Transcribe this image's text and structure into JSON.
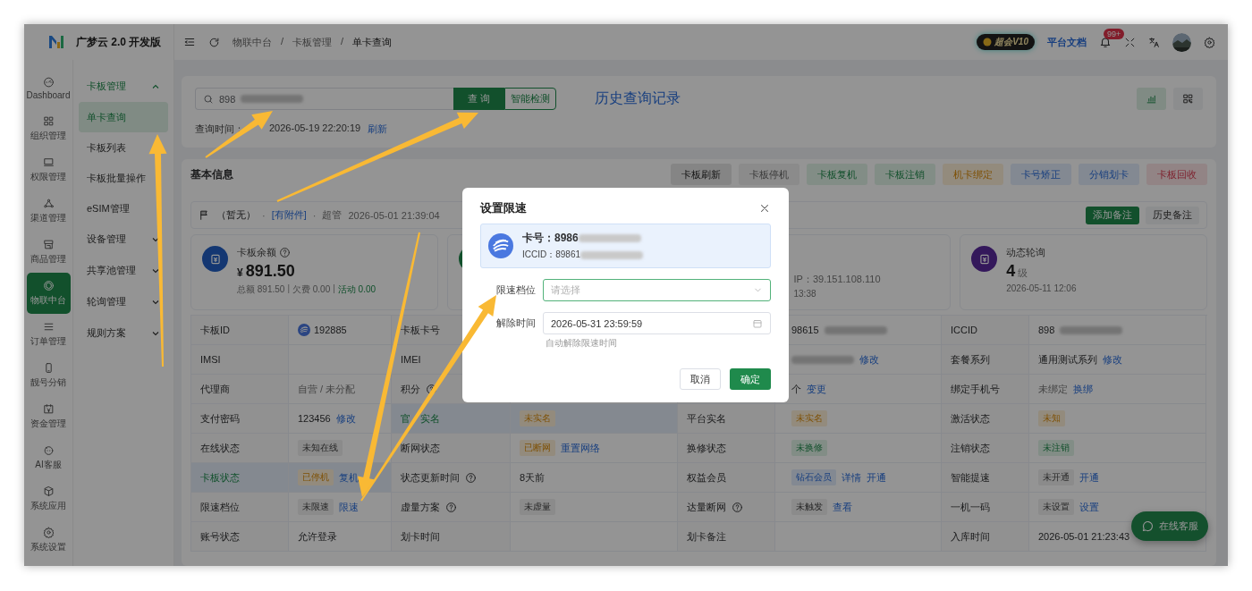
{
  "app": {
    "name": "广梦云 2.0 开发版"
  },
  "rail": [
    {
      "label": "Dashboard",
      "selected": false
    },
    {
      "label": "组织管理",
      "selected": false
    },
    {
      "label": "权限管理",
      "selected": false
    },
    {
      "label": "渠道管理",
      "selected": false
    },
    {
      "label": "商品管理",
      "selected": false
    },
    {
      "label": "物联中台",
      "selected": true
    },
    {
      "label": "订单管理",
      "selected": false
    },
    {
      "label": "靓号分销",
      "selected": false
    },
    {
      "label": "资金管理",
      "selected": false
    },
    {
      "label": "AI客服",
      "selected": false
    },
    {
      "label": "系统应用",
      "selected": false
    },
    {
      "label": "系统设置",
      "selected": false
    }
  ],
  "sidebar": {
    "items": [
      {
        "label": "卡板管理",
        "expanded": true,
        "children": [
          {
            "label": "单卡查询",
            "selected": true
          },
          {
            "label": "卡板列表",
            "selected": false
          },
          {
            "label": "卡板批量操作",
            "selected": false
          },
          {
            "label": "eSIM管理",
            "selected": false
          }
        ]
      },
      {
        "label": "设备管理",
        "expanded": false
      },
      {
        "label": "共享池管理",
        "expanded": false
      },
      {
        "label": "轮询管理",
        "expanded": false
      },
      {
        "label": "规则方案",
        "expanded": false
      }
    ]
  },
  "breadcrumb": [
    "物联中台",
    "/",
    "卡板管理",
    "/",
    "单卡查询"
  ],
  "header": {
    "vip_badge": "超会V10",
    "docs_link": "平台文档",
    "notification_count": "99+"
  },
  "query": {
    "search_value": "898",
    "search_button": "查 询",
    "detect_button": "智能检测",
    "history_link": "历史查询记录",
    "query_time_label": "查询时间：",
    "query_time": "2026-05-19 22:20:19",
    "refresh_link": "刷新"
  },
  "info": {
    "title": "基本信息",
    "actions": [
      {
        "label": "卡板刷新",
        "kind": "dark"
      },
      {
        "label": "卡板停机",
        "kind": "gray"
      },
      {
        "label": "卡板复机",
        "kind": "success"
      },
      {
        "label": "卡板注销",
        "kind": "success"
      },
      {
        "label": "机卡绑定",
        "kind": "warning"
      },
      {
        "label": "卡号矫正",
        "kind": "info"
      },
      {
        "label": "分销划卡",
        "kind": "info"
      },
      {
        "label": "卡板回收",
        "kind": "danger"
      }
    ],
    "remark": {
      "parts": [
        {
          "kind": "text",
          "text": "（暂无）"
        },
        {
          "kind": "dot",
          "text": "·"
        },
        {
          "kind": "link",
          "text": "[有附件]"
        },
        {
          "kind": "dot",
          "text": "·"
        },
        {
          "kind": "muted",
          "text": "超管"
        },
        {
          "kind": "muted",
          "text": "2026-05-01 21:39:04"
        }
      ],
      "buttons": [
        {
          "label": "添加备注",
          "kind": "primary"
        },
        {
          "label": "历史备注",
          "kind": "plain"
        }
      ]
    },
    "cards": [
      {
        "kind": "blue",
        "title": "卡板余额",
        "help": true,
        "currency": "¥",
        "value": "891.50",
        "footer": [
          {
            "kind": "muted",
            "text": "总额 891.50"
          },
          {
            "kind": "sep",
            "text": "|"
          },
          {
            "kind": "muted",
            "text": "欠费 0.00"
          },
          {
            "kind": "sep",
            "text": "|"
          },
          {
            "kind": "success",
            "text": "活动 0.00"
          }
        ]
      },
      {
        "kind": "green"
      },
      {
        "subtitle": "IP：39.151.108.110",
        "footer": [
          {
            "kind": "muted",
            "text": "13:38"
          }
        ]
      },
      {
        "kind": "purple",
        "title": "动态轮询",
        "help": false,
        "value": "4",
        "unit": "级",
        "footer": [
          {
            "kind": "muted",
            "text": "2026-05-11 12:06"
          }
        ]
      }
    ],
    "table": {
      "rows": [
        {
          "pairs": [
            {
              "label": "卡板ID",
              "help": false,
              "highlighted": false,
              "parts": [
                {
                  "kind": "chip",
                  "text": "192885"
                }
              ]
            },
            {
              "label": "卡板卡号",
              "help": false,
              "highlighted": false
            },
            {
              "parts": [
                {
                  "kind": "text",
                  "text": "98615"
                },
                {
                  "kind": "redacted"
                }
              ]
            },
            {
              "label": "ICCID",
              "help": false,
              "highlighted": false,
              "parts": [
                {
                  "kind": "text",
                  "text": "898"
                },
                {
                  "kind": "redacted"
                }
              ]
            }
          ]
        },
        {
          "pairs": [
            {
              "label": "IMSI",
              "help": false,
              "highlighted": false
            },
            {
              "label": "IMEI",
              "help": false,
              "highlighted": false
            },
            {
              "parts": [
                {
                  "kind": "redacted"
                },
                {
                  "kind": "link",
                  "text": "修改"
                }
              ]
            },
            {
              "label": "套餐系列",
              "help": false,
              "highlighted": false,
              "parts": [
                {
                  "kind": "text",
                  "text": "通用测试系列"
                },
                {
                  "kind": "link",
                  "text": "修改"
                }
              ]
            }
          ]
        },
        {
          "pairs": [
            {
              "label": "代理商",
              "help": false,
              "highlighted": false,
              "parts": [
                {
                  "kind": "muted",
                  "text": "自营 / 未分配"
                }
              ]
            },
            {
              "label": "积分",
              "help": true,
              "highlighted": false
            },
            {
              "parts": [
                {
                  "kind": "text",
                  "text": "个"
                },
                {
                  "kind": "link",
                  "text": "变更"
                }
              ]
            },
            {
              "label": "绑定手机号",
              "help": false,
              "highlighted": false,
              "parts": [
                {
                  "kind": "muted",
                  "text": "未绑定"
                },
                {
                  "kind": "link",
                  "text": "换绑"
                }
              ]
            }
          ]
        },
        {
          "pairs": [
            {
              "label": "支付密码",
              "help": false,
              "highlighted": false,
              "parts": [
                {
                  "kind": "text",
                  "text": "123456"
                },
                {
                  "kind": "link",
                  "text": "修改"
                }
              ]
            },
            {
              "label": "官",
              "label_2": "实名",
              "help": false,
              "highlighted": true,
              "parts": [
                {
                  "kind": "warning-tag",
                  "text": "未实名"
                }
              ]
            },
            {
              "label": "平台实名",
              "help": false,
              "highlighted": false,
              "parts": [
                {
                  "kind": "warning-tag",
                  "text": "未实名"
                }
              ]
            },
            {
              "label": "激活状态",
              "help": false,
              "highlighted": false,
              "parts": [
                {
                  "kind": "warning-tag",
                  "text": "未知"
                }
              ]
            }
          ]
        },
        {
          "pairs": [
            {
              "label": "在线状态",
              "help": false,
              "highlighted": false,
              "parts": [
                {
                  "kind": "plain-tag",
                  "text": "未知在线"
                }
              ]
            },
            {
              "label": "断网状态",
              "help": false,
              "highlighted": false,
              "parts": [
                {
                  "kind": "warning-tag",
                  "text": "已断网"
                },
                {
                  "kind": "link",
                  "text": "重置网络"
                }
              ]
            },
            {
              "label": "换修状态",
              "help": false,
              "highlighted": false,
              "parts": [
                {
                  "kind": "success-tag",
                  "text": "未换修"
                }
              ]
            },
            {
              "label": "注销状态",
              "help": false,
              "highlighted": false,
              "parts": [
                {
                  "kind": "success-tag",
                  "text": "未注销"
                }
              ]
            }
          ]
        },
        {
          "pairs": [
            {
              "label": "卡板状态",
              "help": false,
              "highlighted": true,
              "parts": [
                {
                  "kind": "warning-tag",
                  "text": "已停机"
                },
                {
                  "kind": "link",
                  "text": "复机"
                }
              ]
            },
            {
              "label": "状态更新时间",
              "help": true,
              "highlighted": false,
              "parts": [
                {
                  "kind": "text",
                  "text": "8天前"
                }
              ]
            },
            {
              "label": "权益会员",
              "help": false,
              "highlighted": false,
              "parts": [
                {
                  "kind": "info-tag",
                  "text": "钻石会员"
                },
                {
                  "kind": "link",
                  "text": "详情"
                },
                {
                  "kind": "link",
                  "text": "开通"
                }
              ]
            },
            {
              "label": "智能提速",
              "help": false,
              "highlighted": false,
              "parts": [
                {
                  "kind": "plain-tag",
                  "text": "未开通"
                },
                {
                  "kind": "link",
                  "text": "开通"
                }
              ]
            }
          ]
        },
        {
          "pairs": [
            {
              "label": "限速档位",
              "help": false,
              "highlighted": false,
              "parts": [
                {
                  "kind": "plain-tag",
                  "text": "未限速"
                },
                {
                  "kind": "link",
                  "text": "限速"
                }
              ]
            },
            {
              "label": "虚量方案",
              "help": true,
              "highlighted": false,
              "parts": [
                {
                  "kind": "plain-tag",
                  "text": "未虚量"
                }
              ]
            },
            {
              "label": "达量断网",
              "help": true,
              "highlighted": false,
              "parts": [
                {
                  "kind": "plain-tag",
                  "text": "未触发"
                },
                {
                  "kind": "link",
                  "text": "查看"
                }
              ]
            },
            {
              "label": "一机一码",
              "help": false,
              "highlighted": false,
              "parts": [
                {
                  "kind": "plain-tag",
                  "text": "未设置"
                },
                {
                  "kind": "link",
                  "text": "设置"
                }
              ]
            }
          ]
        },
        {
          "pairs": [
            {
              "label": "账号状态",
              "help": false,
              "highlighted": false,
              "parts": [
                {
                  "kind": "text",
                  "text": "允许登录"
                }
              ]
            },
            {
              "label": "划卡时间",
              "help": false,
              "highlighted": false
            },
            {
              "label": "划卡备注",
              "help": false,
              "highlighted": false
            },
            {
              "label": "入库时间",
              "help": false,
              "highlighted": false,
              "parts": [
                {
                  "kind": "text",
                  "text": "2026-05-01 21:23:43"
                }
              ]
            }
          ]
        }
      ]
    }
  },
  "chat_button": {
    "label": "在线客服"
  },
  "modal": {
    "title": "设置限速",
    "card_number": "卡号：8986",
    "iccid": "ICCID：89861",
    "fields": [
      {
        "label": "限速档位",
        "kind": "select",
        "placeholder": "请选择",
        "focused": true
      },
      {
        "label": "解除时间",
        "kind": "date",
        "value": "2026-05-31 23:59:59",
        "hint": "自动解除限速时间",
        "focused": false
      }
    ],
    "buttons": [
      {
        "label": "取消",
        "kind": "plain"
      },
      {
        "label": "确定",
        "kind": "primary"
      }
    ]
  },
  "annotations": [
    {
      "kind": "arrow"
    },
    {
      "kind": "arrow"
    },
    {
      "kind": "arrow"
    },
    {
      "kind": "arrow"
    },
    {
      "kind": "arrow"
    }
  ]
}
